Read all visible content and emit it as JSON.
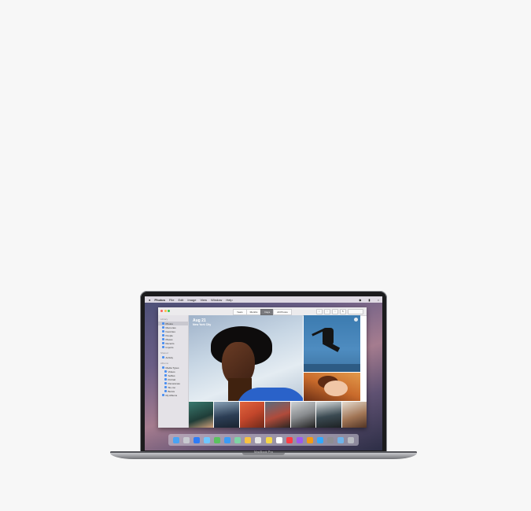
{
  "menubar": {
    "app": "Photos",
    "items": [
      "File",
      "Edit",
      "Image",
      "View",
      "Window",
      "Help"
    ]
  },
  "toolbar": {
    "tabs": [
      "Years",
      "Months",
      "Days",
      "All Photos"
    ],
    "active_tab": "Days"
  },
  "sidebar": {
    "library_header": "Library",
    "library_items": [
      "Photos",
      "Memories",
      "Favorites",
      "People",
      "Places",
      "Recents",
      "Imports"
    ],
    "shared_header": "Shared",
    "shared_items": [
      "Activity"
    ],
    "albums_header": "Albums",
    "albums_items": [
      "Media Types",
      "Videos",
      "Selfies",
      "Portrait",
      "Panoramas",
      "Slo-mo",
      "Bursts",
      "My Albums"
    ]
  },
  "photo_header": {
    "date": "Aug 21",
    "location": "New York City"
  },
  "device": {
    "brand": "MacBook Pro"
  },
  "colors": {
    "background": "#f7f7f7",
    "window": "#ffffff",
    "sidebar": "#e4e2e7",
    "active_tab": "#7a7a7e"
  }
}
